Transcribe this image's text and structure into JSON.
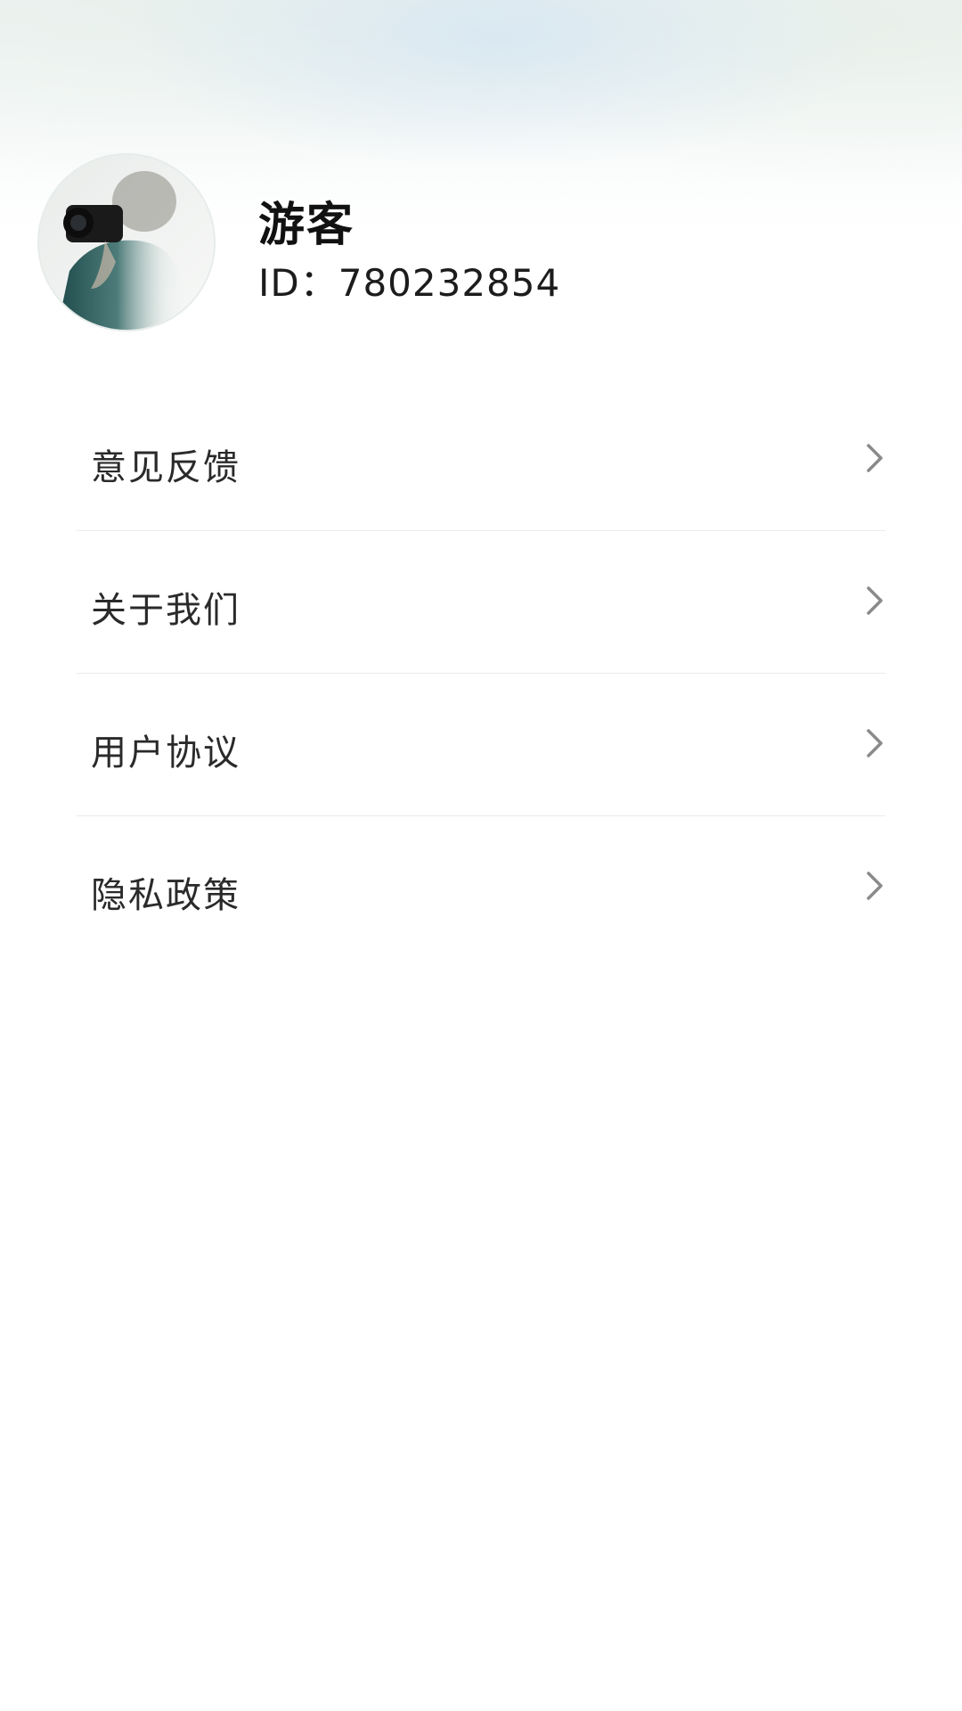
{
  "profile": {
    "avatar_icon": "photographer-avatar",
    "username": "游客",
    "id_text": "ID：780232854"
  },
  "menu": {
    "items": [
      {
        "label": "意见反馈",
        "icon": "chevron-right-icon"
      },
      {
        "label": "关于我们",
        "icon": "chevron-right-icon"
      },
      {
        "label": "用户协议",
        "icon": "chevron-right-icon"
      },
      {
        "label": "隐私政策",
        "icon": "chevron-right-icon"
      }
    ]
  },
  "colors": {
    "text_primary": "#111111",
    "text_menu": "#2a2a2a",
    "chevron": "#8a8a8a",
    "divider": "#ececec"
  }
}
